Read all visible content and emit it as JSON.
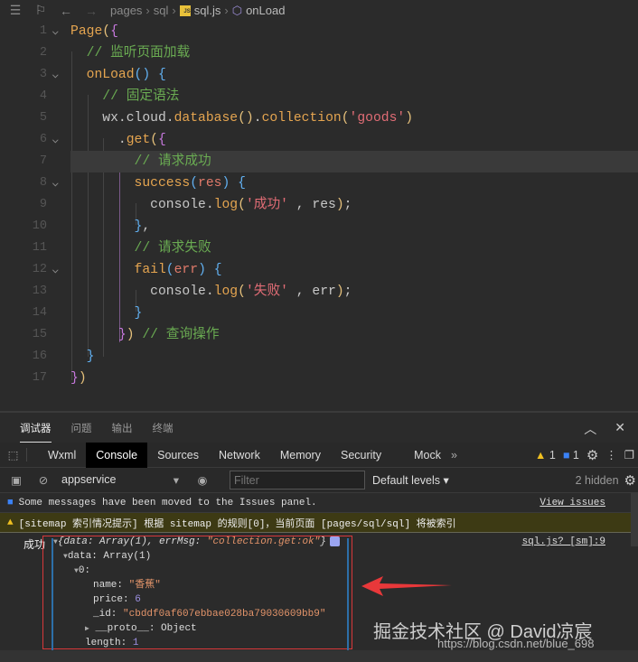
{
  "breadcrumb": {
    "items": [
      "pages",
      "sql",
      "sql.js",
      "onLoad"
    ],
    "js_badge": "JS"
  },
  "editor": {
    "highlighted_line": 7,
    "lines": [
      {
        "n": "1",
        "fold": true,
        "tokens": [
          [
            "Page",
            "kw"
          ],
          [
            "(",
            "b2"
          ],
          [
            "{",
            "b1"
          ]
        ]
      },
      {
        "n": "2",
        "fold": false,
        "tokens": [
          [
            "  // 监听页面加载",
            "cm"
          ]
        ]
      },
      {
        "n": "3",
        "fold": true,
        "tokens": [
          [
            "  ",
            "pl"
          ],
          [
            "onLoad",
            "kw"
          ],
          [
            "()",
            "b3"
          ],
          [
            " {",
            "b3"
          ]
        ]
      },
      {
        "n": "4",
        "fold": false,
        "tokens": [
          [
            "    // 固定语法",
            "cm"
          ]
        ]
      },
      {
        "n": "5",
        "fold": false,
        "tokens": [
          [
            "    wx.cloud.",
            "pl"
          ],
          [
            "database",
            "kw"
          ],
          [
            "()",
            "b2"
          ],
          [
            ".",
            "pl"
          ],
          [
            "collection",
            "kw"
          ],
          [
            "(",
            "b2"
          ],
          [
            "'goods'",
            "st"
          ],
          [
            ")",
            "b2"
          ]
        ]
      },
      {
        "n": "6",
        "fold": true,
        "tokens": [
          [
            "      .",
            "pl"
          ],
          [
            "get",
            "kw"
          ],
          [
            "(",
            "b2"
          ],
          [
            "{",
            "b1"
          ]
        ]
      },
      {
        "n": "7",
        "fold": false,
        "tokens": [
          [
            "        // 请求成功",
            "cm"
          ]
        ]
      },
      {
        "n": "8",
        "fold": true,
        "tokens": [
          [
            "        ",
            "pl"
          ],
          [
            "success",
            "kw"
          ],
          [
            "(",
            "b3"
          ],
          [
            "res",
            "pr"
          ],
          [
            ")",
            "b3"
          ],
          [
            " {",
            "b3"
          ]
        ]
      },
      {
        "n": "9",
        "fold": false,
        "tokens": [
          [
            "          console.",
            "pl"
          ],
          [
            "log",
            "kw"
          ],
          [
            "(",
            "b2"
          ],
          [
            "'成功'",
            "st"
          ],
          [
            " , res",
            "pl"
          ],
          [
            ")",
            "b2"
          ],
          [
            ";",
            "pl"
          ]
        ]
      },
      {
        "n": "10",
        "fold": false,
        "tokens": [
          [
            "        }",
            "b3"
          ],
          [
            ",",
            "pl"
          ]
        ]
      },
      {
        "n": "11",
        "fold": false,
        "tokens": [
          [
            "        // 请求失败",
            "cm"
          ]
        ]
      },
      {
        "n": "12",
        "fold": true,
        "tokens": [
          [
            "        ",
            "pl"
          ],
          [
            "fail",
            "kw"
          ],
          [
            "(",
            "b3"
          ],
          [
            "err",
            "pr"
          ],
          [
            ")",
            "b3"
          ],
          [
            " {",
            "b3"
          ]
        ]
      },
      {
        "n": "13",
        "fold": false,
        "tokens": [
          [
            "          console.",
            "pl"
          ],
          [
            "log",
            "kw"
          ],
          [
            "(",
            "b2"
          ],
          [
            "'失败'",
            "st"
          ],
          [
            " , err",
            "pl"
          ],
          [
            ")",
            "b2"
          ],
          [
            ";",
            "pl"
          ]
        ]
      },
      {
        "n": "14",
        "fold": false,
        "tokens": [
          [
            "        }",
            "b3"
          ]
        ]
      },
      {
        "n": "15",
        "fold": false,
        "tokens": [
          [
            "      }",
            "b1"
          ],
          [
            ")",
            "b2"
          ],
          [
            " // 查询操作",
            "cm"
          ]
        ]
      },
      {
        "n": "16",
        "fold": false,
        "tokens": [
          [
            "  }",
            "b3"
          ]
        ]
      },
      {
        "n": "17",
        "fold": false,
        "tokens": [
          [
            "}",
            "b1"
          ],
          [
            ")",
            "b2"
          ]
        ]
      }
    ]
  },
  "panel_tabs": [
    "调试器",
    "问题",
    "输出",
    "终端"
  ],
  "devtools_tabs": [
    "Wxml",
    "Console",
    "Sources",
    "Network",
    "Memory",
    "Security",
    "Mock"
  ],
  "more_tabs": "»",
  "warning_count": "1",
  "info_count": "1",
  "console_toolbar": {
    "context": "appservice",
    "filter_placeholder": "Filter",
    "levels": "Default levels ▾",
    "hidden": "2 hidden"
  },
  "messages": {
    "info": "Some messages have been moved to the Issues panel.",
    "view_issues": "View issues",
    "warning": "[sitemap 索引情况提示] 根据 sitemap 的规则[0]，当前页面 [pages/sql/sql] 将被索引"
  },
  "log": {
    "label": "成功",
    "source": "sql.js? [sm]:9",
    "summary_prefix": "{data: Array(1), errMsg: ",
    "summary_str": "\"collection.get:ok\"",
    "summary_suffix": "}",
    "data_key": "data: Array(1)",
    "index_key": "0:",
    "name_key": "name: ",
    "name_val": "\"香蕉\"",
    "price_key": "price: ",
    "price_val": "6",
    "id_key": "_id: ",
    "id_val": "\"cbddf0af607ebbae028ba79030609bb9\"",
    "proto": "__proto__: Object",
    "length_key": "length: ",
    "length_val": "1"
  },
  "watermark": {
    "text": "掘金技术社区 @ David凉宸",
    "url": "https://blog.csdn.net/blue_698"
  }
}
